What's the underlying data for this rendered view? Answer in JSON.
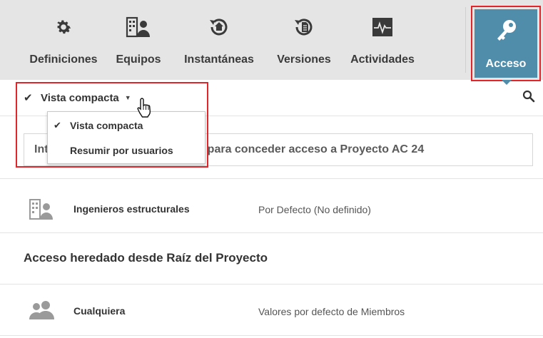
{
  "toolbar": {
    "items": [
      {
        "label": "Definiciones",
        "icon": "gear-icon"
      },
      {
        "label": "Equipos",
        "icon": "team-icon"
      },
      {
        "label": "Instantáneas",
        "icon": "snapshot-icon"
      },
      {
        "label": "Versiones",
        "icon": "versions-icon"
      },
      {
        "label": "Actividades",
        "icon": "activity-icon"
      }
    ],
    "active": {
      "label": "Acceso",
      "icon": "key-icon"
    }
  },
  "view": {
    "current": "Vista compacta",
    "options": [
      "Vista compacta",
      "Resumir por usuarios"
    ]
  },
  "add_input": {
    "placeholder": "Introduzca un usuario o equipo para conceder acceso a Proyecto AC 24"
  },
  "members": [
    {
      "name": "Ingenieros estructurales",
      "role": "Por Defecto  (No definido)",
      "icon": "team-icon"
    }
  ],
  "inherited": {
    "title": "Acceso heredado desde Raíz del Proyecto",
    "members": [
      {
        "name": "Cualquiera",
        "role": "Valores por defecto de Miembros",
        "icon": "group-icon"
      }
    ]
  },
  "colors": {
    "accent": "#4f8dab",
    "highlight": "#e0262b",
    "toolbar_bg": "#e5e5e5"
  }
}
